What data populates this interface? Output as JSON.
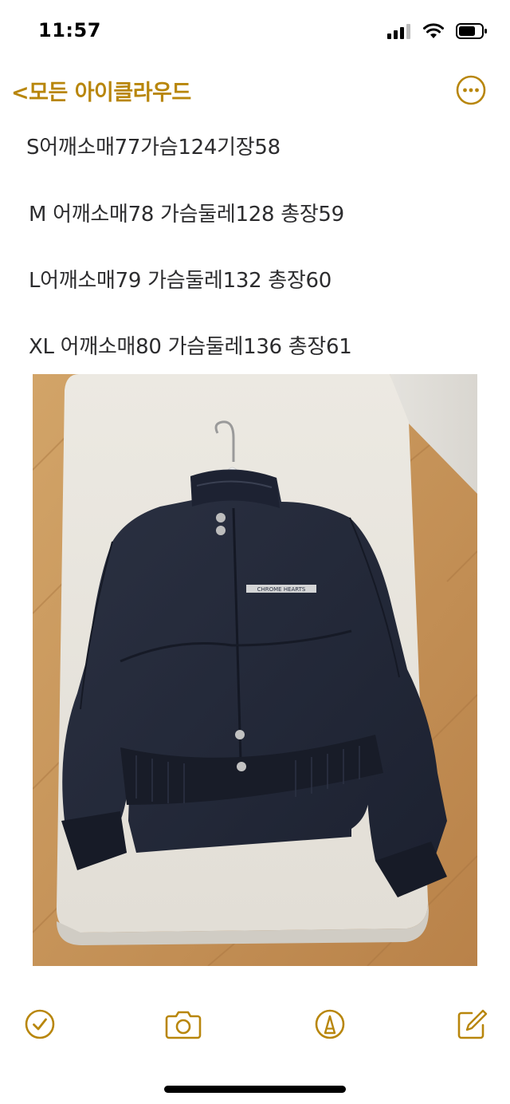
{
  "status_bar": {
    "time": "11:57",
    "icons": [
      "cellular-signal-icon",
      "wifi-icon",
      "battery-icon"
    ]
  },
  "nav": {
    "back_label": "<모든 아이클라우드",
    "more_icon": "ellipsis-circle-icon"
  },
  "note": {
    "lines": [
      "S어깨소매77가슴124기장58",
      "M 어깨소매78 가슴둘레128 총장59",
      "L어깨소매79 가슴둘레132 총장60",
      "XL 어깨소매80 가슴둘레136 총장61"
    ],
    "image": {
      "subject": "navy jacket on hanger laid on white cushion over wooden floor",
      "chest_logo_text": "CHROME HEARTS"
    }
  },
  "toolbar": {
    "icons": [
      "checklist-icon",
      "camera-icon",
      "markup-pen-icon",
      "compose-icon"
    ]
  },
  "colors": {
    "accent": "#b8860b",
    "text": "#2c2c2e",
    "jacket": "#232838",
    "floor": "#c8965a",
    "cushion": "#e9e6df"
  }
}
